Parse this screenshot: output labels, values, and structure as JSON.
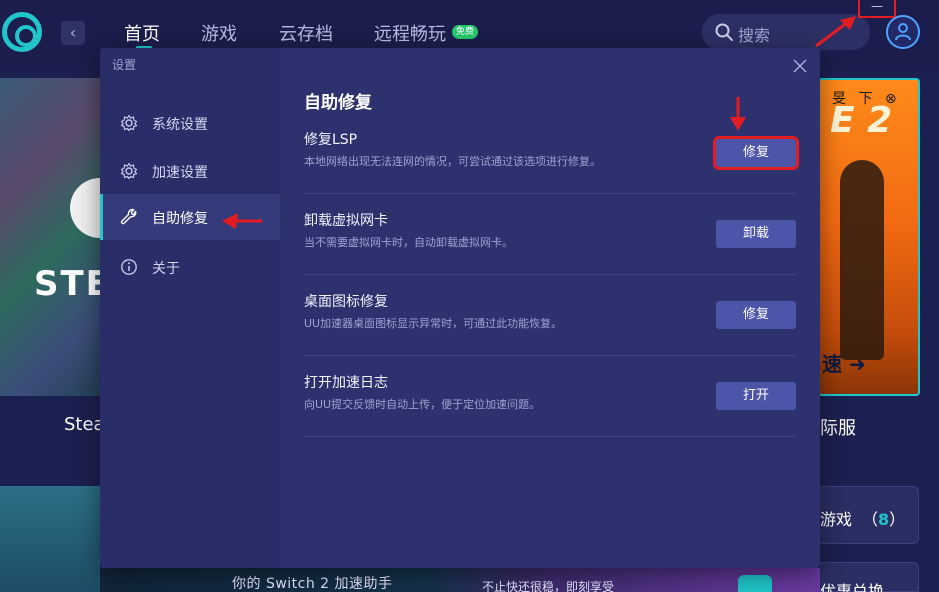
{
  "nav": {
    "tabs": [
      {
        "label": "首页",
        "active": true
      },
      {
        "label": "游戏",
        "active": false
      },
      {
        "label": "云存档",
        "active": false
      },
      {
        "label": "远程畅玩",
        "active": false
      }
    ],
    "free_badge": "免费",
    "search_placeholder": "搜索",
    "minimize_symbol": "—"
  },
  "background": {
    "left_caption": "Stea",
    "steam_banner_word": "STE",
    "right_caption": "际服",
    "cs_title": "E 2",
    "cs_top_icons": "旻 下 ⊗",
    "cs_speed": "速 ➜",
    "bottom_banner_text": "你的 Switch 2 加速助手",
    "bottom_banner_text2": "不止快还很稳，即刻享受",
    "my_games_label": "游戏",
    "my_games_count": "8",
    "promo_label": "优惠兑换"
  },
  "modal": {
    "title": "设置",
    "sidebar": [
      {
        "label": "系统设置",
        "icon": "gear-icon",
        "active": false
      },
      {
        "label": "加速设置",
        "icon": "gear-icon",
        "active": false
      },
      {
        "label": "自助修复",
        "icon": "wrench-icon",
        "active": true
      },
      {
        "label": "关于",
        "icon": "info-icon",
        "active": false
      }
    ],
    "section_title": "自助修复",
    "rows": [
      {
        "title": "修复LSP",
        "desc": "本地网络出现无法连网的情况，可尝试通过该选项进行修复。",
        "button": "修复"
      },
      {
        "title": "卸载虚拟网卡",
        "desc": "当不需要虚拟网卡时，自动卸载虚拟网卡。",
        "button": "卸载"
      },
      {
        "title": "桌面图标修复",
        "desc": "UU加速器桌面图标显示异常时，可通过此功能恢复。",
        "button": "修复"
      },
      {
        "title": "打开加速日志",
        "desc": "向UU提交反馈时自动上传，便于定位加速问题。",
        "button": "打开"
      }
    ]
  },
  "colors": {
    "accent": "#20c6c9",
    "annotation_red": "#e31c23",
    "button": "#4c55a8",
    "modal_bg": "#2d316e"
  }
}
